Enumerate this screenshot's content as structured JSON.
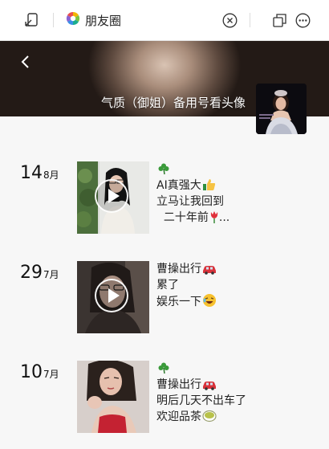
{
  "topbar": {
    "title": "朋友圈",
    "icons": [
      "dock-back-icon",
      "moments-logo-icon",
      "close-circle-icon",
      "window-restore-icon",
      "more-icon"
    ]
  },
  "cover": {
    "profile_name": "气质（御姐）备用号看头像"
  },
  "posts": [
    {
      "day": "14",
      "month": "8月",
      "has_video": true,
      "lines": [
        "",
        "AI真强大",
        "立马让我回到",
        "  二十年前"
      ],
      "emojis": [
        "clover-icon",
        "thumbs-up-icon",
        "tulip-icon"
      ]
    },
    {
      "day": "29",
      "month": "7月",
      "has_video": true,
      "lines": [
        "曹操出行",
        "累了",
        "娱乐一下"
      ],
      "emojis": [
        "car-icon",
        "laughing-icon"
      ]
    },
    {
      "day": "10",
      "month": "7月",
      "has_video": false,
      "lines": [
        "",
        "曹操出行",
        "明后几天不出车了",
        "欢迎品茶"
      ],
      "emojis": [
        "clover-icon",
        "car-icon",
        "tea-icon"
      ]
    }
  ],
  "colors": {
    "topbar_bg": "#ffffff",
    "page_bg": "#f7f7f7",
    "text": "#111111",
    "cover_dark": "#1d1612"
  }
}
